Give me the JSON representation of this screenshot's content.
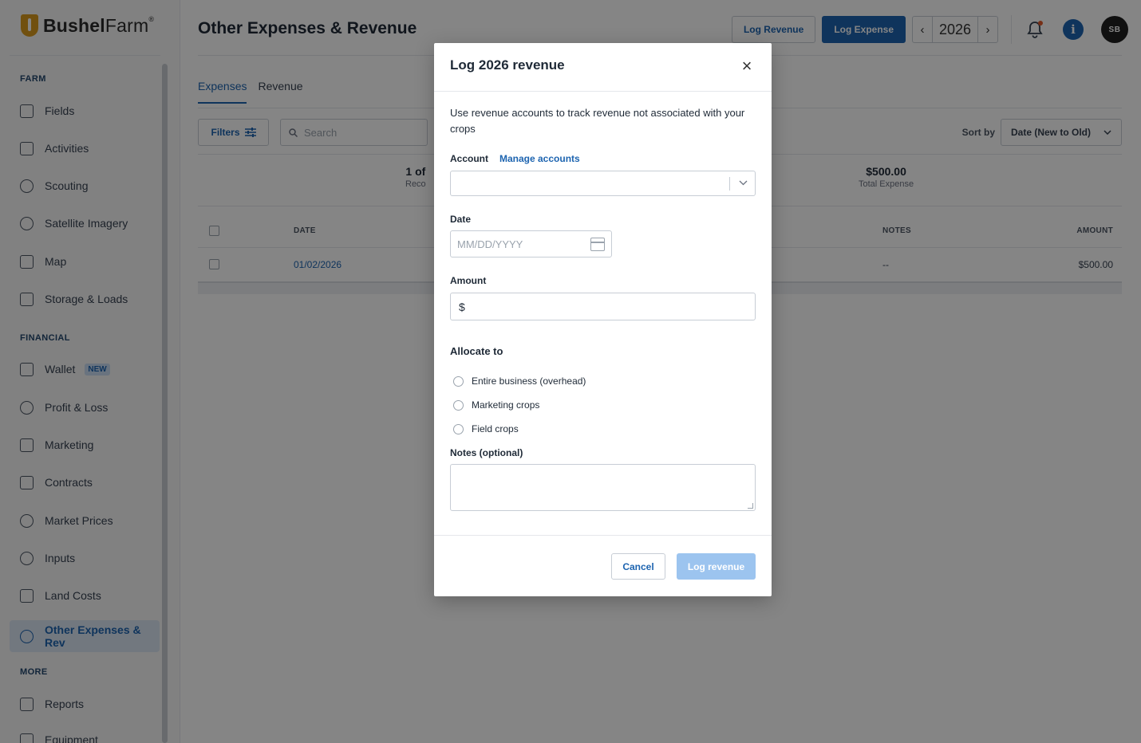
{
  "brand": {
    "name_bold": "Bushel",
    "name_light": "Farm",
    "trademark": "®"
  },
  "sidebar": {
    "sections": [
      {
        "label": "FARM"
      },
      {
        "label": "FINANCIAL"
      },
      {
        "label": "MORE"
      }
    ],
    "items": [
      {
        "label": "Fields",
        "icon": "fields-icon"
      },
      {
        "label": "Activities",
        "icon": "activities-icon"
      },
      {
        "label": "Scouting",
        "icon": "binoculars-icon"
      },
      {
        "label": "Satellite Imagery",
        "icon": "satellite-icon"
      },
      {
        "label": "Map",
        "icon": "map-icon"
      },
      {
        "label": "Storage & Loads",
        "icon": "storage-icon"
      },
      {
        "label": "Wallet",
        "icon": "wallet-icon",
        "badge": "NEW"
      },
      {
        "label": "Profit & Loss",
        "icon": "profit-loss-icon"
      },
      {
        "label": "Marketing",
        "icon": "marketing-icon"
      },
      {
        "label": "Contracts",
        "icon": "contracts-icon"
      },
      {
        "label": "Market Prices",
        "icon": "market-prices-icon"
      },
      {
        "label": "Inputs",
        "icon": "inputs-icon"
      },
      {
        "label": "Land Costs",
        "icon": "land-costs-icon"
      },
      {
        "label": "Other Expenses & Rev",
        "icon": "other-expenses-icon",
        "active": true
      },
      {
        "label": "Reports",
        "icon": "reports-icon"
      },
      {
        "label": "Equipment",
        "icon": "equipment-icon"
      }
    ]
  },
  "header": {
    "title": "Other Expenses & Revenue",
    "log_revenue": "Log Revenue",
    "log_expense": "Log Expense",
    "year": "2026",
    "prev": "‹",
    "next": "›",
    "avatar_initials": "SB",
    "info_glyph": "i",
    "bell_glyph": "🔔"
  },
  "tabs": [
    {
      "label": "Expenses",
      "active": true
    },
    {
      "label": "Revenue",
      "active": false
    }
  ],
  "toolbar": {
    "filters": "Filters",
    "search_placeholder": "Search",
    "sort_label": "Sort by",
    "sort_value": "Date (New to Old)"
  },
  "summary": [
    {
      "value": "1 of",
      "label": "Reco"
    },
    {
      "value": "$500.00",
      "label": "Total Expense"
    }
  ],
  "table": {
    "columns": [
      "DATE",
      "NOTES",
      "AMOUNT"
    ],
    "rows": [
      {
        "date": "01/02/2026",
        "notes": "--",
        "amount": "$500.00"
      }
    ]
  },
  "modal": {
    "title": "Log 2026 revenue",
    "close": "×",
    "description": "Use revenue accounts to track revenue not associated with your crops",
    "account_label": "Account",
    "manage_accounts": "Manage accounts",
    "account_value": "",
    "date_label": "Date",
    "date_placeholder": "MM/DD/YYYY",
    "amount_label": "Amount",
    "amount_prefix": "$",
    "allocate_label": "Allocate to",
    "allocate_options": [
      "Entire business (overhead)",
      "Marketing crops",
      "Field crops"
    ],
    "notes_label": "Notes (optional)",
    "notes_value": "",
    "cancel": "Cancel",
    "submit": "Log revenue"
  },
  "colors": {
    "primary": "#1d64b0",
    "disabled_primary": "#9cc4ef",
    "brand_gold": "#d99a1e"
  }
}
